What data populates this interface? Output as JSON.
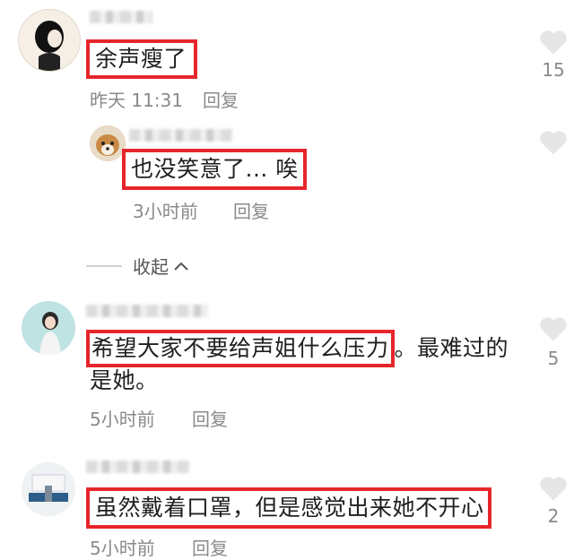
{
  "comments": [
    {
      "text": "余声瘦了",
      "time": "昨天 11:31",
      "reply_label": "回复",
      "likes": "15",
      "reply_thread": {
        "text": "也没笑意了... 唉",
        "time": "3小时前",
        "reply_label": "回复"
      },
      "collapse_label": "收起"
    },
    {
      "text_highlighted": "希望大家不要给声姐什么压力",
      "text_rest_line1": "。最难过的",
      "text_line2": "是她。",
      "time": "5小时前",
      "reply_label": "回复",
      "likes": "5"
    },
    {
      "text": "虽然戴着口罩，但是感觉出来她不开心",
      "time": "5小时前",
      "reply_label": "回复",
      "likes": "2"
    }
  ],
  "colors": {
    "highlight_border": "#e5262b",
    "meta_text": "#8a8a8a",
    "heart": "#e6e6e6"
  },
  "icons": [
    "heart-icon",
    "chevron-up-icon"
  ]
}
